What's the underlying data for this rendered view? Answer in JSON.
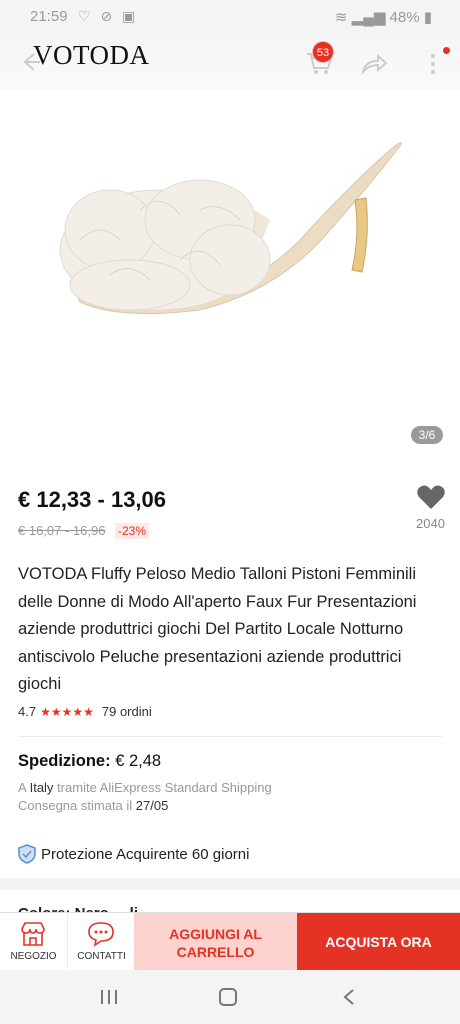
{
  "status_bar": {
    "time": "21:59",
    "left_icons": "♡ ⊘ ▣",
    "battery": "48%"
  },
  "header": {
    "brand": "VOTODA",
    "cart_count": "53"
  },
  "gallery": {
    "counter": "3/6"
  },
  "price": {
    "range": "€ 12,33 - 13,06",
    "old_range": "€ 16,07 - 16,96",
    "discount": "-23%",
    "wishlist_count": "2040"
  },
  "product": {
    "title": "VOTODA Fluffy Peloso Medio Talloni Pistoni Femminili delle Donne di Modo All'aperto Faux Fur Presentazioni aziende produttrici giochi Del Partito Locale Notturno antiscivolo Peluche presentazioni aziende produttrici giochi",
    "rating": "4.7",
    "stars": "★★★★★",
    "orders": "79 ordini"
  },
  "shipping": {
    "label": "Spedizione:",
    "cost": "€ 2,48",
    "line1_prefix": "A",
    "line1_country": "Italy",
    "line1_rest": "tramite AliExpress Standard Shipping",
    "line2_prefix": "Consegna stimata il",
    "line2_date": "27/05"
  },
  "protection": {
    "label": "Protezione Acquirente 60 giorni"
  },
  "peek": {
    "text": "Colore: Nero ... li"
  },
  "bottom_bar": {
    "shop_label": "NEGOZIO",
    "contact_label": "CONTATTI",
    "add_cart_line1": "AGGIUNGI AL",
    "add_cart_line2": "CARRELLO",
    "buy_now": "ACQUISTA ORA"
  },
  "colors": {
    "accent": "#e43225",
    "accent_light": "#fdd3cf"
  }
}
